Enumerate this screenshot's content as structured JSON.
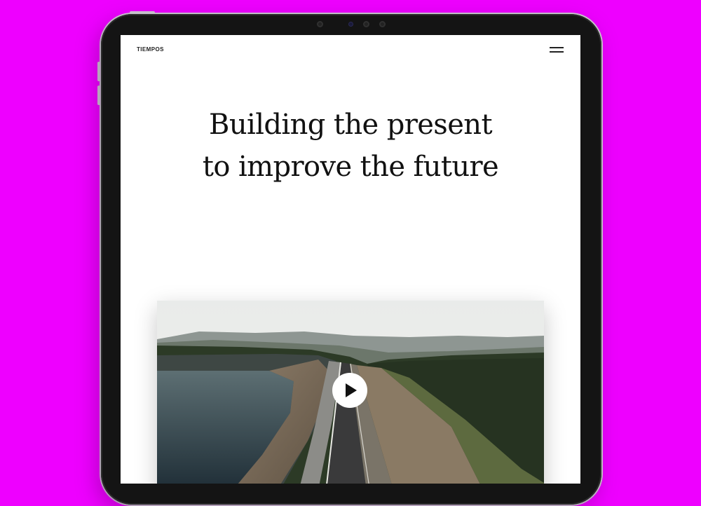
{
  "brand": {
    "name": "TIEMPOS"
  },
  "header": {
    "menu_icon": "hamburger-menu-icon"
  },
  "hero": {
    "headline_line1": "Building the present",
    "headline_line2": "to improve the future"
  },
  "video": {
    "play_icon": "play-icon"
  },
  "colors": {
    "background": "#ee00ff",
    "device_frame": "#141414",
    "screen": "#ffffff",
    "text": "#111111"
  }
}
